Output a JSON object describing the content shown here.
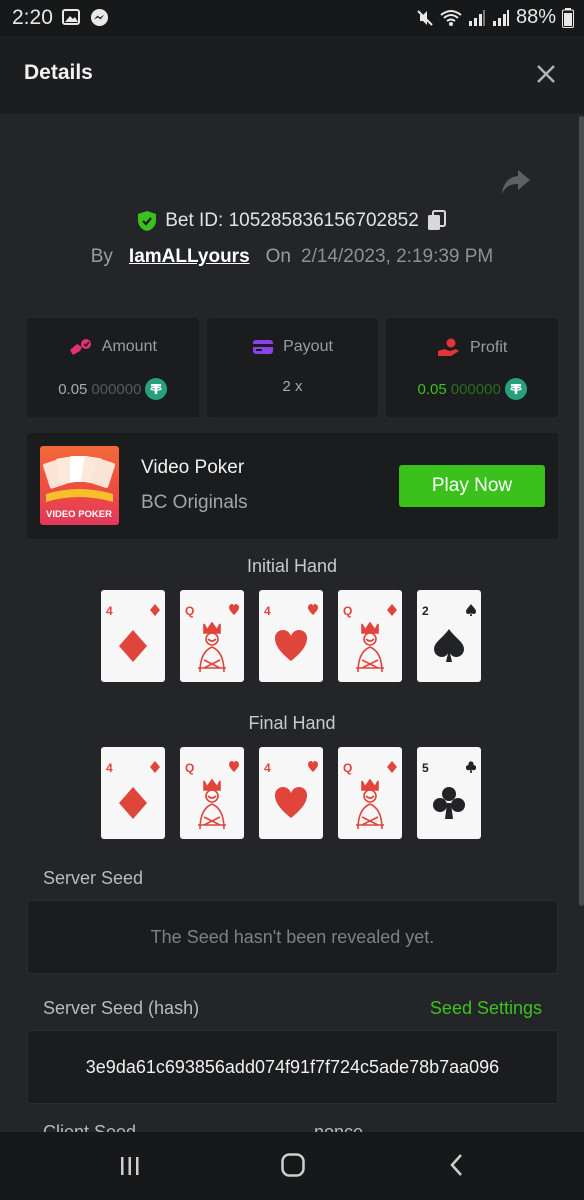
{
  "status_bar": {
    "time": "2:20",
    "battery": "88%"
  },
  "header": {
    "title": "Details"
  },
  "bet": {
    "id_label": "Bet ID: 105285836156702852",
    "by_label": "By",
    "username": "IamALLyours",
    "on_label": "On",
    "date": "2/14/2023, 2:19:39 PM"
  },
  "stats": {
    "amount": {
      "label": "Amount",
      "value_strong": "0.05",
      "value_dim": "000000"
    },
    "payout": {
      "label": "Payout",
      "value": "2 x"
    },
    "profit": {
      "label": "Profit",
      "value_strong": "0.05",
      "value_dim": "000000"
    }
  },
  "game": {
    "name": "Video Poker",
    "provider": "BC Originals",
    "play_label": "Play Now",
    "thumb_text": "VIDEO POKER"
  },
  "hands": {
    "initial_title": "Initial Hand",
    "final_title": "Final Hand",
    "initial": [
      {
        "rank": "4",
        "suit": "diamond",
        "color": "red"
      },
      {
        "rank": "Q",
        "suit": "heart",
        "color": "red"
      },
      {
        "rank": "4",
        "suit": "heart",
        "color": "red"
      },
      {
        "rank": "Q",
        "suit": "diamond",
        "color": "red"
      },
      {
        "rank": "2",
        "suit": "spade",
        "color": "black"
      }
    ],
    "final": [
      {
        "rank": "4",
        "suit": "diamond",
        "color": "red"
      },
      {
        "rank": "Q",
        "suit": "heart",
        "color": "red"
      },
      {
        "rank": "4",
        "suit": "heart",
        "color": "red"
      },
      {
        "rank": "Q",
        "suit": "diamond",
        "color": "red"
      },
      {
        "rank": "5",
        "suit": "club",
        "color": "black"
      }
    ]
  },
  "seeds": {
    "server_seed_label": "Server Seed",
    "server_seed_value": "The Seed hasn't been revealed yet.",
    "server_hash_label": "Server Seed (hash)",
    "seed_settings_label": "Seed Settings",
    "server_hash_value": "3e9da61c693856add074f91f7f724c5ade78b7aa096",
    "client_seed_label": "Client Seed",
    "nonce_label": "nonce"
  },
  "colors": {
    "accent_green": "#3bc11c",
    "panel": "#1b1c1e",
    "background": "#232528"
  }
}
